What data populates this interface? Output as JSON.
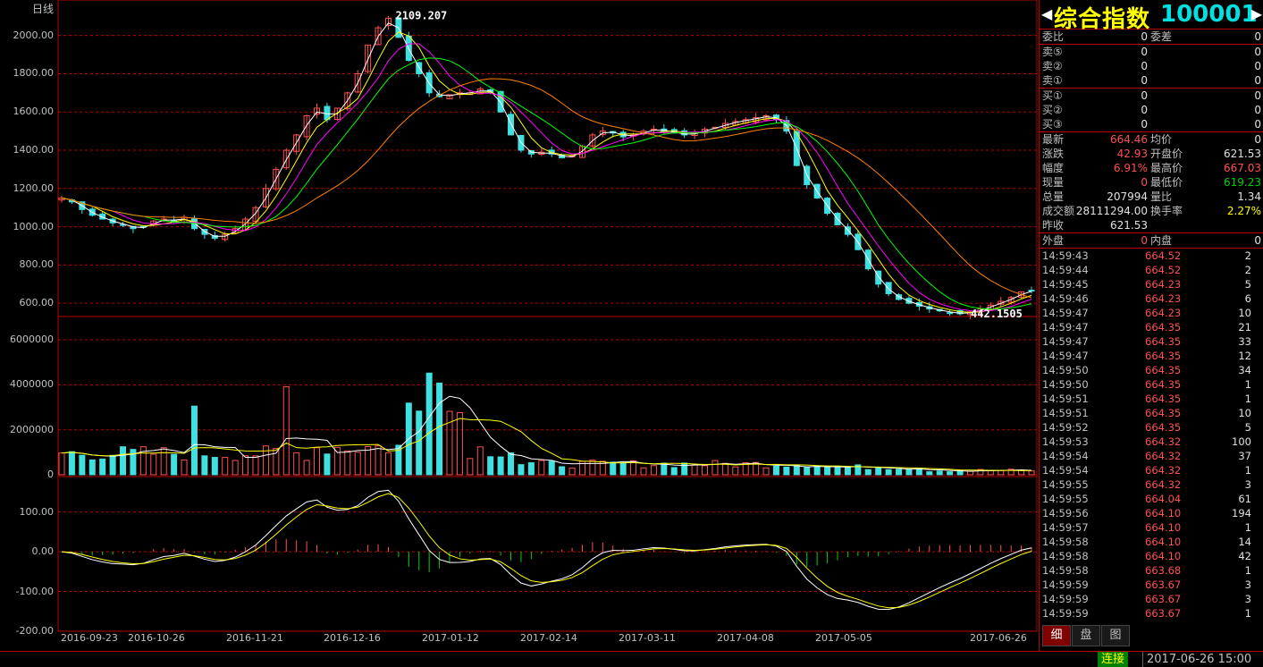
{
  "period_label": "日线",
  "price_axis": [
    "2000.00",
    "1800.00",
    "1600.00",
    "1400.00",
    "1200.00",
    "1000.00",
    "800.00",
    "600.00"
  ],
  "volume_axis": [
    "6000000",
    "4000000",
    "2000000",
    "0"
  ],
  "macd_axis": [
    "100.00",
    "0.00",
    "-100.00",
    "-200.00"
  ],
  "date_labels": [
    "2016-09-23",
    "2016-10-26",
    "2016-11-21",
    "2016-12-16",
    "2017-01-12",
    "2017-02-14",
    "2017-03-11",
    "2017-04-08",
    "2017-05-05",
    "2017-06-26"
  ],
  "chart_data": {
    "type": "candlestick",
    "price_range": [
      540,
      2120
    ],
    "high_annotation": "2109.207",
    "low_annotation": "442.1505",
    "ma_colors": [
      "#ffffff",
      "#ffff00",
      "#ff00ff",
      "#00ff00",
      "#ff8000"
    ],
    "up_color": "#ff5050",
    "down_color": "#40e0e0",
    "price_path": [
      [
        0,
        1150
      ],
      [
        12,
        1130
      ],
      [
        25,
        1090
      ],
      [
        38,
        1060
      ],
      [
        50,
        1040
      ],
      [
        62,
        1020
      ],
      [
        75,
        1010
      ],
      [
        88,
        990
      ],
      [
        100,
        1000
      ],
      [
        112,
        1030
      ],
      [
        125,
        1040
      ],
      [
        137,
        1030
      ],
      [
        150,
        1050
      ],
      [
        160,
        990
      ],
      [
        172,
        960
      ],
      [
        185,
        940
      ],
      [
        198,
        960
      ],
      [
        210,
        990
      ],
      [
        222,
        1040
      ],
      [
        235,
        1100
      ],
      [
        248,
        1200
      ],
      [
        260,
        1300
      ],
      [
        272,
        1400
      ],
      [
        285,
        1480
      ],
      [
        297,
        1580
      ],
      [
        305,
        1620
      ],
      [
        315,
        1560
      ],
      [
        325,
        1620
      ],
      [
        335,
        1700
      ],
      [
        345,
        1800
      ],
      [
        355,
        1950
      ],
      [
        365,
        2040
      ],
      [
        372,
        2090
      ],
      [
        378,
        1990
      ],
      [
        385,
        1870
      ],
      [
        393,
        1800
      ],
      [
        402,
        1700
      ],
      [
        412,
        1680
      ],
      [
        422,
        1690
      ],
      [
        432,
        1700
      ],
      [
        442,
        1700
      ],
      [
        452,
        1720
      ],
      [
        462,
        1700
      ],
      [
        472,
        1600
      ],
      [
        482,
        1480
      ],
      [
        492,
        1400
      ],
      [
        502,
        1380
      ],
      [
        512,
        1390
      ],
      [
        522,
        1380
      ],
      [
        532,
        1360
      ],
      [
        542,
        1370
      ],
      [
        552,
        1420
      ],
      [
        562,
        1480
      ],
      [
        572,
        1500
      ],
      [
        582,
        1490
      ],
      [
        592,
        1470
      ],
      [
        602,
        1480
      ],
      [
        612,
        1500
      ],
      [
        622,
        1510
      ],
      [
        632,
        1500
      ],
      [
        642,
        1490
      ],
      [
        652,
        1480
      ],
      [
        662,
        1490
      ],
      [
        672,
        1510
      ],
      [
        682,
        1520
      ],
      [
        692,
        1540
      ],
      [
        702,
        1550
      ],
      [
        712,
        1560
      ],
      [
        722,
        1570
      ],
      [
        732,
        1580
      ],
      [
        742,
        1560
      ],
      [
        752,
        1500
      ],
      [
        762,
        1320
      ],
      [
        772,
        1220
      ],
      [
        782,
        1150
      ],
      [
        792,
        1070
      ],
      [
        802,
        1010
      ],
      [
        812,
        960
      ],
      [
        822,
        880
      ],
      [
        832,
        780
      ],
      [
        842,
        700
      ],
      [
        852,
        650
      ],
      [
        862,
        620
      ],
      [
        872,
        600
      ],
      [
        882,
        585
      ],
      [
        892,
        570
      ],
      [
        902,
        560
      ],
      [
        912,
        550
      ],
      [
        922,
        545
      ],
      [
        932,
        555
      ],
      [
        942,
        570
      ],
      [
        952,
        590
      ],
      [
        962,
        610
      ],
      [
        972,
        630
      ],
      [
        982,
        660
      ],
      [
        990,
        664.46
      ]
    ],
    "volume_axis_max": 7000000,
    "macd_range": [
      -200,
      160
    ]
  },
  "panel": {
    "title_name": "综合指数",
    "title_code": "100001",
    "weibi": {
      "label": "委比",
      "value": "0",
      "label2": "委差",
      "value2": "0"
    },
    "asks": [
      {
        "label": "卖⑤",
        "price": "0",
        "vol": "0"
      },
      {
        "label": "卖②",
        "price": "0",
        "vol": "0"
      },
      {
        "label": "卖①",
        "price": "0",
        "vol": "0"
      }
    ],
    "bids": [
      {
        "label": "买①",
        "price": "0",
        "vol": "0"
      },
      {
        "label": "买②",
        "price": "0",
        "vol": "0"
      },
      {
        "label": "买③",
        "price": "0",
        "vol": "0"
      }
    ],
    "quote": [
      {
        "l1": "最新",
        "v1": "664.46",
        "c1": "red",
        "l2": "均价",
        "v2": "0",
        "c2": "wht"
      },
      {
        "l1": "涨跌",
        "v1": "42.93",
        "c1": "red",
        "l2": "开盘价",
        "v2": "621.53",
        "c2": "wht"
      },
      {
        "l1": "幅度",
        "v1": "6.91%",
        "c1": "red",
        "l2": "最高价",
        "v2": "667.03",
        "c2": "red"
      },
      {
        "l1": "现量",
        "v1": "0",
        "c1": "red",
        "l2": "最低价",
        "v2": "619.23",
        "c2": "grn"
      },
      {
        "l1": "总量",
        "v1": "207994",
        "c1": "wht",
        "l2": "量比",
        "v2": "1.34",
        "c2": "wht"
      },
      {
        "l1": "成交额",
        "v1": "28111294.00",
        "c1": "wht",
        "l2": "换手率",
        "v2": "2.27%",
        "c2": "yel"
      },
      {
        "l1": "昨收",
        "v1": "621.53",
        "c1": "wht",
        "l2": "",
        "v2": "",
        "c2": "wht"
      }
    ],
    "outer": {
      "label": "外盘",
      "value": "0",
      "label2": "内盘",
      "value2": "0"
    },
    "ticks": [
      [
        "14:59:43",
        "664.52",
        "2"
      ],
      [
        "14:59:44",
        "664.52",
        "2"
      ],
      [
        "14:59:45",
        "664.23",
        "5"
      ],
      [
        "14:59:46",
        "664.23",
        "6"
      ],
      [
        "14:59:47",
        "664.23",
        "10"
      ],
      [
        "14:59:47",
        "664.35",
        "21"
      ],
      [
        "14:59:47",
        "664.35",
        "33"
      ],
      [
        "14:59:47",
        "664.35",
        "12"
      ],
      [
        "14:59:50",
        "664.35",
        "34"
      ],
      [
        "14:59:50",
        "664.35",
        "1"
      ],
      [
        "14:59:51",
        "664.35",
        "1"
      ],
      [
        "14:59:51",
        "664.35",
        "10"
      ],
      [
        "14:59:52",
        "664.35",
        "5"
      ],
      [
        "14:59:53",
        "664.32",
        "100"
      ],
      [
        "14:59:54",
        "664.32",
        "37"
      ],
      [
        "14:59:54",
        "664.32",
        "1"
      ],
      [
        "14:59:55",
        "664.32",
        "3"
      ],
      [
        "14:59:55",
        "664.04",
        "61"
      ],
      [
        "14:59:56",
        "664.10",
        "194"
      ],
      [
        "14:59:57",
        "664.10",
        "1"
      ],
      [
        "14:59:58",
        "664.10",
        "14"
      ],
      [
        "14:59:58",
        "664.10",
        "42"
      ],
      [
        "14:59:58",
        "663.68",
        "1"
      ],
      [
        "14:59:59",
        "663.67",
        "3"
      ],
      [
        "14:59:59",
        "663.67",
        "3"
      ],
      [
        "14:59:59",
        "663.67",
        "1"
      ]
    ],
    "tabs": [
      "细",
      "盘",
      "图"
    ]
  },
  "status": {
    "connection": "连接",
    "datetime": "2017-06-26 15:00"
  }
}
